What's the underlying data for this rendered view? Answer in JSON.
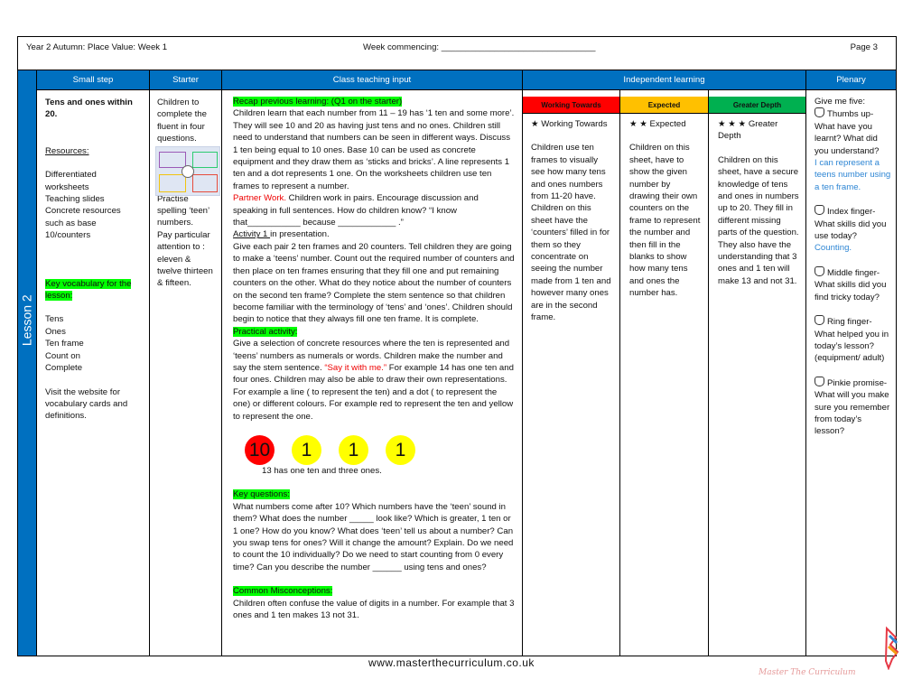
{
  "header": {
    "title": "Year 2 Autumn: Place Value: Week 1",
    "week": "Week commencing: ________________________________",
    "page": "Page 3"
  },
  "lesson_label": "Lesson 2",
  "columns": {
    "small_step": "Small step",
    "starter": "Starter",
    "class": "Class teaching input",
    "independent": "Independent learning",
    "plenary": "Plenary"
  },
  "small_step": {
    "title": "Tens and ones within 20.",
    "resources_label": "Resources:",
    "resources": [
      "Differentiated worksheets",
      "Teaching slides",
      "Concrete resources such as base 10/counters"
    ],
    "vocab_label": "Key vocabulary for the lesson:",
    "vocab": [
      "Tens",
      "Ones",
      "Ten frame",
      "Count on",
      "Complete"
    ],
    "website": "Visit the website for vocabulary cards and definitions."
  },
  "starter": {
    "intro": "Children to complete the fluent in four questions.",
    "practise": "Practise spelling ‘teen’ numbers.",
    "attention": "Pay particular attention to : eleven & twelve thirteen & fifteen."
  },
  "teaching": {
    "recap_label": "Recap previous learning: (Q1 on the starter)",
    "recap": "Children learn that each number from 11 – 19 has  ‘1 ten and some more’. They will see 10 and 20 as having just tens and no ones. Children still need to understand that numbers can be seen in different ways. Discuss 1 ten being equal to 10 ones. Base 10 can be used as concrete equipment and they draw them as ‘sticks and bricks’. A line represents 1 ten and a dot represents 1 one. On the worksheets children use ten frames to represent a number.",
    "partner_label": "Partner Work.",
    "partner": " Children work  in pairs. Encourage discussion and speaking in full sentences. How do children know?  “I know that___________ because ____________ .”",
    "activity_label": "Activity 1 ",
    "activity_rest": "in presentation.",
    "activity": "Give each pair 2 ten frames and 20 counters. Tell children they are going to make a ‘teens’ number. Count out the required number of counters and then place on ten frames ensuring that they fill one and put remaining counters on the other. What do they notice about the number of counters on the second ten frame? Complete the stem sentence so that children become familiar with the terminology of ‘tens’ and ‘ones’. Children should begin to notice that they always fill one ten frame. It is complete.",
    "practical_label": "Practical activity:",
    "practical_a": "Give a selection of concrete resources where the ten is represented and ‘teens’ numbers as numerals or words. Children make the number and say the stem sentence. ",
    "say_it": "“Say it with me.”",
    "practical_b": " For example 14 has one ten and four ones. Children may also be able to draw their own representations. For example a line ( to represent the ten) and a dot ( to represent the one) or different colours. For example red to represent the ten and yellow to represent the one.",
    "counters": [
      {
        "value": "10",
        "color": "#ff0000"
      },
      {
        "value": "1",
        "color": "#ffff00"
      },
      {
        "value": "1",
        "color": "#ffff00"
      },
      {
        "value": "1",
        "color": "#ffff00"
      }
    ],
    "counters_caption": "13 has one ten and three ones.",
    "key_q_label": "Key questions:",
    "key_q": "What numbers come after 10? Which numbers have the ‘teen’ sound in them? What does the number _____ look like? Which is greater, 1 ten or 1 one? How do you know? What does ‘teen’ tell us about a number? Can you swap tens for ones? Will it change the amount? Explain. Do we need to count the 10 individually? Do we need to start counting from 0 every time? Can  you describe the number ______ using tens and ones?",
    "misc_label": "Common Misconceptions:",
    "misc": "Children often confuse the value of digits in a number. For example that 3 ones and 1 ten makes 13 not 31."
  },
  "independent": [
    {
      "header": "Working Towards",
      "color": "#ff0000",
      "stars": "★",
      "label": "Working Towards",
      "text": "Children use ten frames to visually see how many tens and ones numbers from 11-20 have. Children on this sheet have the ‘counters’ filled in for them so they concentrate on seeing the number made from 1 ten and however many ones are in the second frame."
    },
    {
      "header": "Expected",
      "color": "#ffc000",
      "stars": "★ ★",
      "label": "Expected",
      "text": "Children on this sheet, have to show the given number by drawing their own counters on the frame to represent the number and then fill in the blanks to show how many tens and ones the number has."
    },
    {
      "header": "Greater Depth",
      "color": "#00b050",
      "stars": "★ ★ ★",
      "label": "Greater Depth",
      "text": "Children on this sheet, have a secure knowledge of tens and ones in numbers up to 20. They fill in different missing parts of the question. They also have the understanding that 3 ones and 1 ten will make 13 and not 31."
    }
  ],
  "plenary": {
    "intro": "Give me five:",
    "thumb": "Thumbs up- What have you learnt? What did you understand?",
    "thumb_answer": "I can represent a teens number using a ten frame.",
    "index": "Index finger- What skills did you use today?",
    "index_answer": "Counting.",
    "middle": "Middle finger- What skills did you find tricky today?",
    "ring": "Ring finger- What helped you in today’s lesson? (equipment/ adult)",
    "pinkie": "Pinkie promise- What will you make sure you remember from today’s lesson?"
  },
  "footer": {
    "url": "www.masterthecurriculum.co.uk",
    "logo_text": "Master The Curriculum"
  }
}
